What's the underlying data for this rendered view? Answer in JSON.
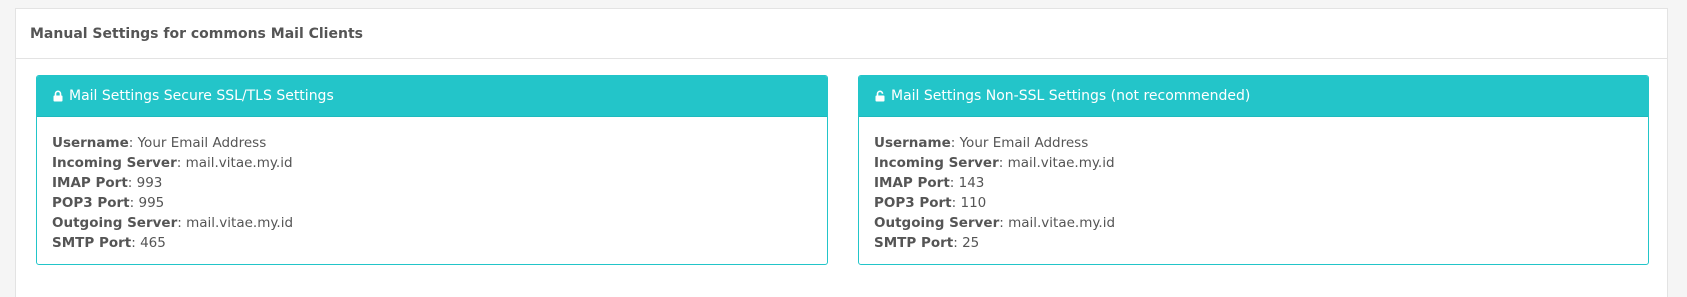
{
  "header": {
    "title": "Manual Settings for commons Mail Clients"
  },
  "panels": [
    {
      "heading": "Mail Settings Secure SSL/TLS Settings",
      "icon": "lock-icon",
      "rows": [
        {
          "label": "Username",
          "value": ": Your Email Address"
        },
        {
          "label": "Incoming Server",
          "value": ": mail.vitae.my.id"
        },
        {
          "label": "IMAP Port",
          "value": ": 993"
        },
        {
          "label": "POP3 Port",
          "value": ": 995"
        },
        {
          "label": "Outgoing Server",
          "value": ": mail.vitae.my.id"
        },
        {
          "label": "SMTP Port",
          "value": ": 465"
        }
      ]
    },
    {
      "heading": "Mail Settings Non-SSL Settings (not recommended)",
      "icon": "unlock-icon",
      "rows": [
        {
          "label": "Username",
          "value": ": Your Email Address"
        },
        {
          "label": "Incoming Server",
          "value": ": mail.vitae.my.id"
        },
        {
          "label": "IMAP Port",
          "value": ": 143"
        },
        {
          "label": "POP3 Port",
          "value": ": 110"
        },
        {
          "label": "Outgoing Server",
          "value": ": mail.vitae.my.id"
        },
        {
          "label": "SMTP Port",
          "value": ": 25"
        }
      ]
    }
  ],
  "colors": {
    "accent": "#23c5c9",
    "border": "#e3e3e3",
    "text": "#555555"
  }
}
